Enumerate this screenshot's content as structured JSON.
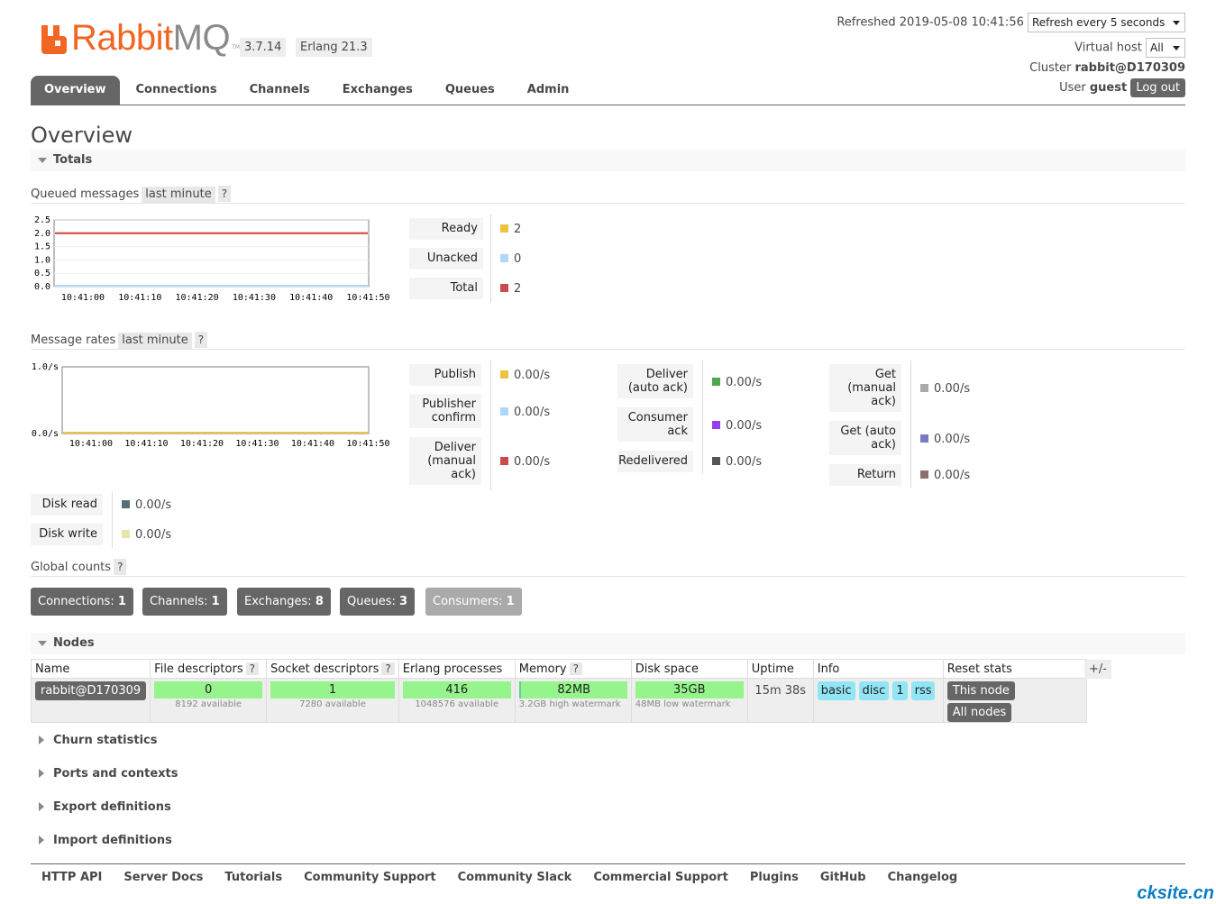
{
  "header": {
    "logo_left": "Rabbit",
    "logo_right": "MQ",
    "logo_tm": "TM",
    "version": "3.7.14",
    "erlang": "Erlang 21.3",
    "refreshed": "Refreshed 2019-05-08 10:41:56",
    "refresh_select": "Refresh every 5 seconds",
    "vhost_label": "Virtual host",
    "vhost_select": "All",
    "cluster_label": "Cluster",
    "cluster_name": "rabbit@D170309",
    "user_label": "User",
    "user_name": "guest",
    "logout": "Log out"
  },
  "tabs": [
    "Overview",
    "Connections",
    "Channels",
    "Exchanges",
    "Queues",
    "Admin"
  ],
  "page_title": "Overview",
  "totals": {
    "section": "Totals",
    "queued_label": "Queued messages",
    "queued_range": "last minute",
    "qmark": "?",
    "queued_chart": {
      "type": "line",
      "x": [
        "10:41:00",
        "10:41:10",
        "10:41:20",
        "10:41:30",
        "10:41:40",
        "10:41:50"
      ],
      "yticks": [
        "2.5",
        "2.0",
        "1.5",
        "1.0",
        "0.5",
        "0.0"
      ],
      "ylim": [
        0,
        2.5
      ],
      "series": [
        {
          "name": "Ready",
          "color": "#edc240",
          "values": [
            2,
            2,
            2,
            2,
            2,
            2
          ]
        },
        {
          "name": "Unacked",
          "color": "#afd8f8",
          "values": [
            0,
            0,
            0,
            0,
            0,
            0
          ]
        },
        {
          "name": "Total",
          "color": "#cb4b4b",
          "values": [
            2,
            2,
            2,
            2,
            2,
            2
          ]
        }
      ]
    },
    "queued_legend": [
      {
        "label": "Ready",
        "value": "2",
        "color": "#edc240"
      },
      {
        "label": "Unacked",
        "value": "0",
        "color": "#afd8f8"
      },
      {
        "label": "Total",
        "value": "2",
        "color": "#cb4b4b"
      }
    ],
    "rates_label": "Message rates",
    "rates_range": "last minute",
    "rates_chart": {
      "type": "line",
      "x": [
        "10:41:00",
        "10:41:10",
        "10:41:20",
        "10:41:30",
        "10:41:40",
        "10:41:50"
      ],
      "yticks": [
        "1.0/s",
        "0.0/s"
      ],
      "ylim": [
        0,
        1.0
      ],
      "series": [
        {
          "name": "Publish",
          "color": "#edc240",
          "values": [
            0,
            0,
            0,
            0,
            0,
            0
          ]
        }
      ]
    },
    "rates_col1": [
      {
        "label": "Publish",
        "value": "0.00/s",
        "color": "#edc240"
      },
      {
        "label": "Publisher confirm",
        "value": "0.00/s",
        "color": "#afd8f8"
      },
      {
        "label": "Deliver (manual ack)",
        "value": "0.00/s",
        "color": "#cb4b4b"
      }
    ],
    "rates_col2": [
      {
        "label": "Deliver (auto ack)",
        "value": "0.00/s",
        "color": "#4da74d"
      },
      {
        "label": "Consumer ack",
        "value": "0.00/s",
        "color": "#9440ed"
      },
      {
        "label": "Redelivered",
        "value": "0.00/s",
        "color": "#545454"
      }
    ],
    "rates_col3": [
      {
        "label": "Get (manual ack)",
        "value": "0.00/s",
        "color": "#aaaaaa"
      },
      {
        "label": "Get (auto ack)",
        "value": "0.00/s",
        "color": "#7c79c3"
      },
      {
        "label": "Return",
        "value": "0.00/s",
        "color": "#8d6f6f"
      }
    ],
    "disk": [
      {
        "label": "Disk read",
        "value": "0.00/s",
        "color": "#546e7a"
      },
      {
        "label": "Disk write",
        "value": "0.00/s",
        "color": "#e6e6a8"
      }
    ],
    "global_label": "Global counts",
    "global_counts": [
      {
        "label": "Connections:",
        "value": "1"
      },
      {
        "label": "Channels:",
        "value": "1"
      },
      {
        "label": "Exchanges:",
        "value": "8"
      },
      {
        "label": "Queues:",
        "value": "3"
      },
      {
        "label": "Consumers:",
        "value": "1"
      }
    ]
  },
  "nodes": {
    "section": "Nodes",
    "plusminus": "+/-",
    "headers": [
      "Name",
      "File descriptors",
      "Socket descriptors",
      "Erlang processes",
      "Memory",
      "Disk space",
      "Uptime",
      "Info",
      "Reset stats"
    ],
    "row": {
      "name": "rabbit@D170309",
      "fd": "0",
      "fd_sub": "8192 available",
      "sd": "1",
      "sd_sub": "7280 available",
      "ep": "416",
      "ep_sub": "1048576 available",
      "mem": "82MB",
      "mem_sub": "3.2GB high watermark",
      "disk": "35GB",
      "disk_sub": "48MB low watermark",
      "uptime": "15m 38s",
      "info": [
        "basic",
        "disc",
        "1",
        "rss"
      ],
      "reset": [
        "This node",
        "All nodes"
      ]
    }
  },
  "collapsed_sections": [
    "Churn statistics",
    "Ports and contexts",
    "Export definitions",
    "Import definitions"
  ],
  "footer": [
    "HTTP API",
    "Server Docs",
    "Tutorials",
    "Community Support",
    "Community Slack",
    "Commercial Support",
    "Plugins",
    "GitHub",
    "Changelog"
  ],
  "watermark": "cksite.cn"
}
